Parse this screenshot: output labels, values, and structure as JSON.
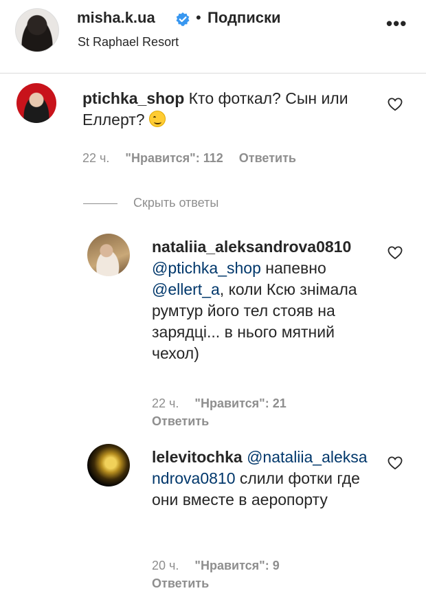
{
  "header": {
    "username": "misha.k.ua",
    "separator": "•",
    "follow_label": "Подписки",
    "location": "St Raphael Resort",
    "more_label": "•••"
  },
  "comments": [
    {
      "username": "ptichka_shop",
      "text": " Кто фоткал? Сын или Еллерт?",
      "time": "22 ч.",
      "likes": "\"Нравится\": 112",
      "reply_label": "Ответить"
    },
    {
      "username": "nataliia_aleksandrova0810",
      "mention1": "@ptichka_shop",
      "text1": " напевно ",
      "mention2": "@ellert_a",
      "text2": ", коли Ксю знімала румтур його тел стояв на зарядці... в нього мятний чехол)",
      "time": "22 ч.",
      "likes": "\"Нравится\": 21",
      "reply_label": "Ответить"
    },
    {
      "username": "lelevitochka",
      "mention": "@nataliia_aleksandrova0810",
      "text": " слили фотки где они вместе в аеропорту",
      "time": "20 ч.",
      "likes": "\"Нравится\": 9",
      "reply_label": "Ответить"
    }
  ],
  "hide_replies_label": "Скрыть ответы",
  "icons": {
    "verified": "verified-badge-icon",
    "heart": "heart-outline-icon",
    "emoji": "smirk-emoji-icon"
  },
  "colors": {
    "verified_blue": "#3897f0",
    "mention": "#00376b",
    "secondary_text": "#8e8e8e"
  }
}
